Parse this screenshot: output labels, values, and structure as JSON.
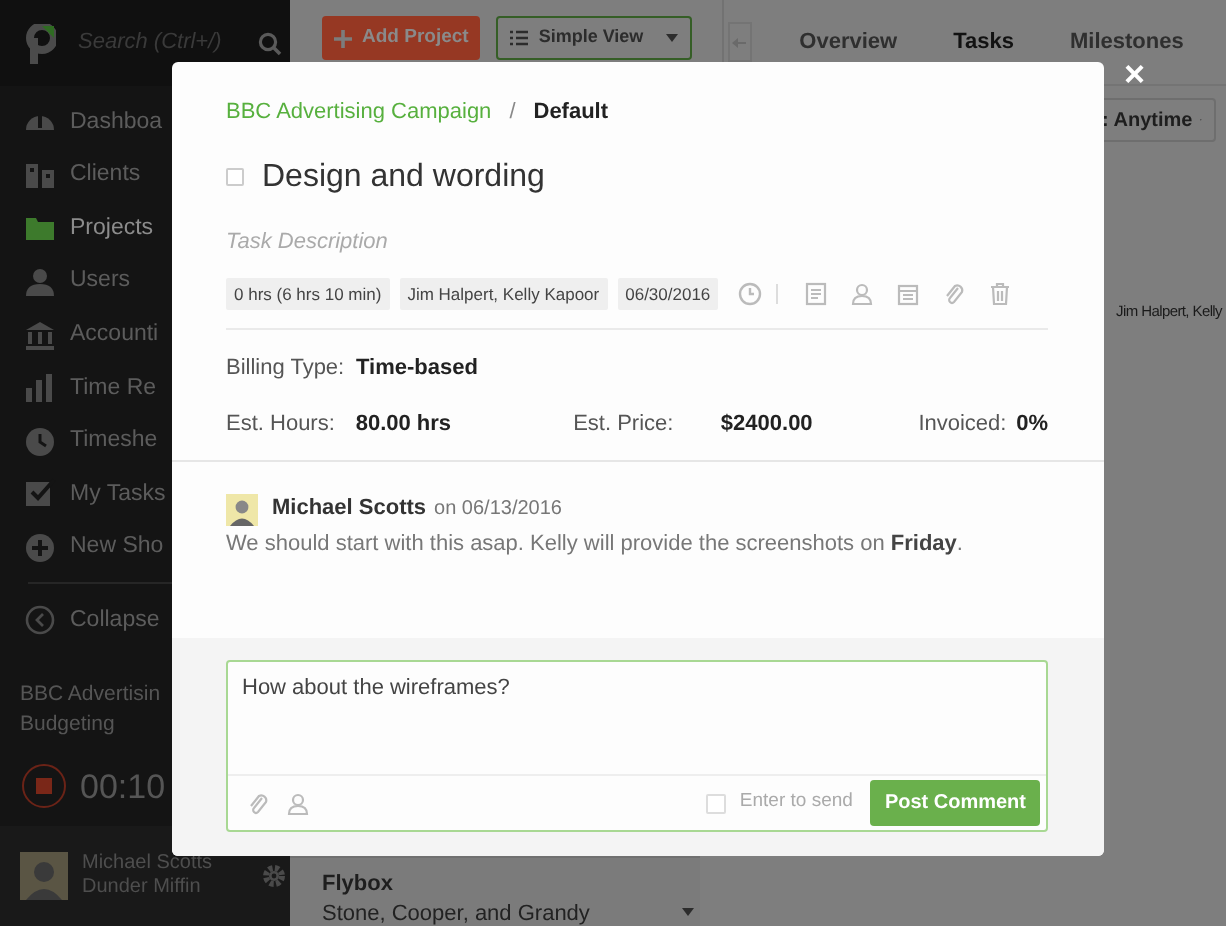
{
  "sidebar": {
    "search": {
      "placeholder": "Search (Ctrl+/)"
    },
    "items": [
      {
        "label": "Dashboa",
        "selected": false
      },
      {
        "label": "Clients",
        "selected": false
      },
      {
        "label": "Projects",
        "selected": true
      },
      {
        "label": "Users",
        "selected": false
      },
      {
        "label": "Accounti",
        "selected": false
      },
      {
        "label": "Time Re",
        "selected": false
      },
      {
        "label": "Timeshe",
        "selected": false
      },
      {
        "label": "My Tasks",
        "selected": false
      },
      {
        "label": "New Sho",
        "selected": false
      }
    ],
    "collapse": "Collapse",
    "timer": {
      "project": "BBC Advertisin",
      "task": "Budgeting",
      "time": "00:10"
    },
    "user": {
      "name": "Michael Scotts",
      "company": "Dunder Miffin"
    }
  },
  "toolbar": {
    "add_button": "Add Project",
    "view_dropdown": "Simple View"
  },
  "tabs": [
    {
      "label": "Overview",
      "selected": false
    },
    {
      "label": "Tasks",
      "selected": true
    },
    {
      "label": "Milestones",
      "selected": false
    }
  ],
  "filter": ": Anytime",
  "background_cell": "Jim Halpert, Kelly",
  "project_list": {
    "title": "Flybox",
    "client": "Stone, Cooper, and Grandy"
  },
  "modal": {
    "breadcrumb": {
      "project": "BBC Advertising Campaign",
      "separator": "/",
      "list": "Default"
    },
    "task": {
      "title": "Design and wording",
      "completed": false,
      "description_placeholder": "Task Description",
      "tags": [
        "0 hrs (6 hrs 10 min)",
        "Jim Halpert, Kelly Kapoor",
        "06/30/2016"
      ]
    },
    "billing": {
      "label": "Billing Type:",
      "value": "Time-based"
    },
    "estimates": [
      {
        "label": "Est. Hours:",
        "value": "80.00 hrs"
      },
      {
        "label": "Est. Price:",
        "value": "$2400.00"
      },
      {
        "label": "Invoiced:",
        "value": "0%"
      }
    ],
    "comments": [
      {
        "author": "Michael Scotts",
        "date": "on 06/13/2016",
        "text": "We should start with this asap. Kelly will provide the screenshots on **Friday**."
      }
    ],
    "composer": {
      "value": "How about the wireframes?",
      "enter_to_send": {
        "label": "Enter to send",
        "checked": false
      },
      "submit": "Post Comment"
    },
    "close": "×"
  }
}
